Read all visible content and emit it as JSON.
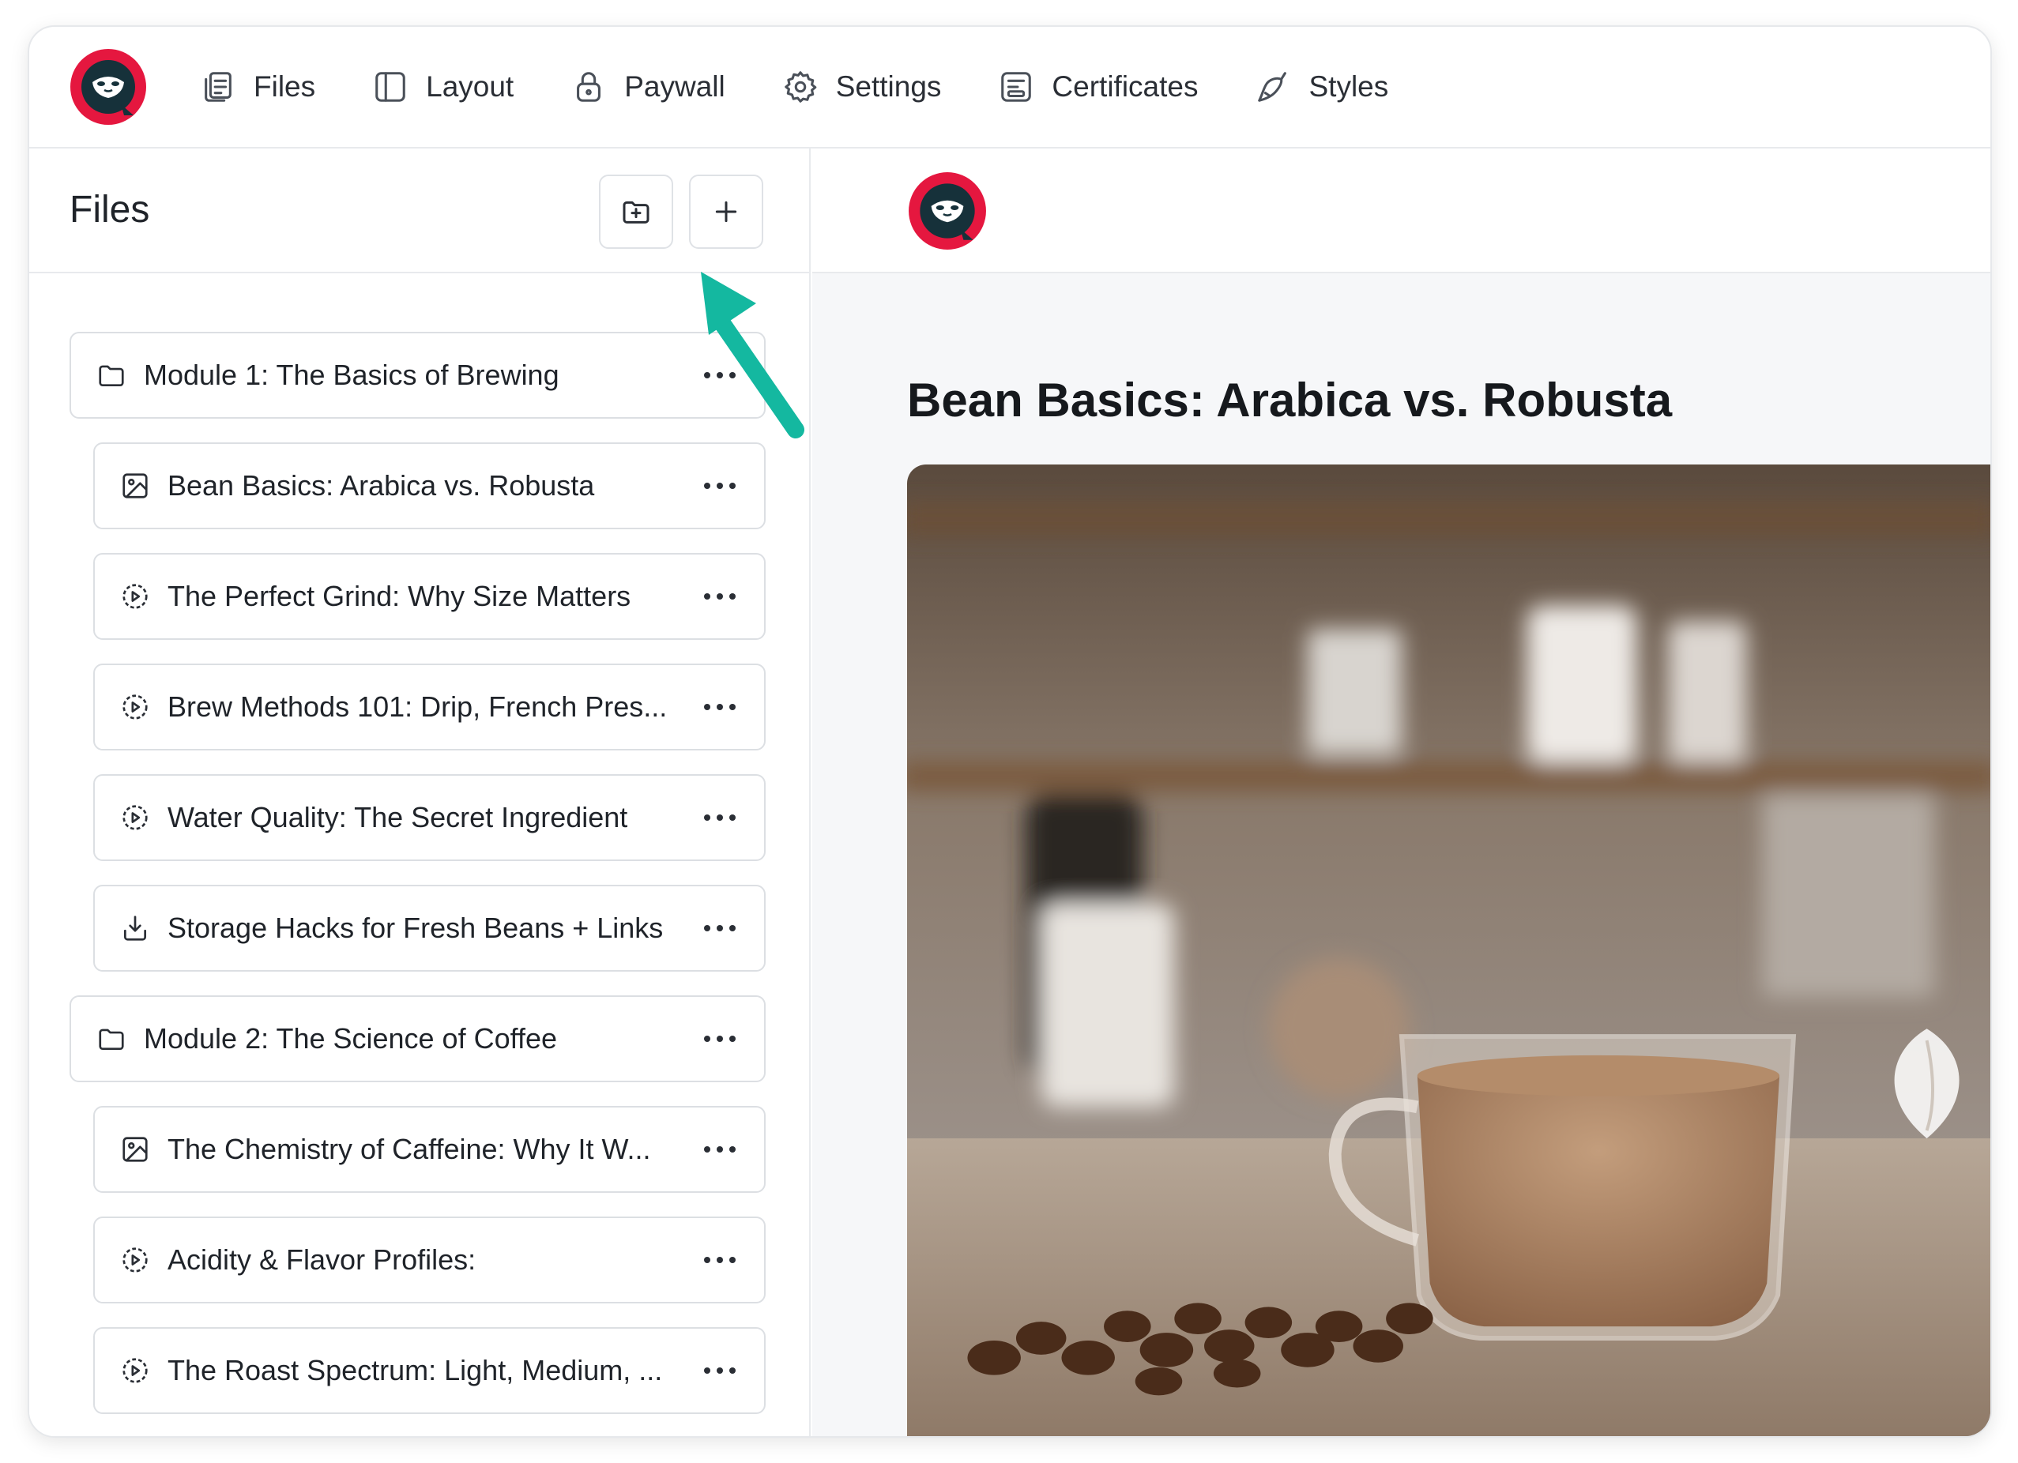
{
  "nav": {
    "items": [
      {
        "label": "Files",
        "icon": "files-icon"
      },
      {
        "label": "Layout",
        "icon": "layout-icon"
      },
      {
        "label": "Paywall",
        "icon": "lock-icon"
      },
      {
        "label": "Settings",
        "icon": "gear-icon"
      },
      {
        "label": "Certificates",
        "icon": "certificate-icon"
      },
      {
        "label": "Styles",
        "icon": "brush-icon"
      }
    ]
  },
  "sidebar": {
    "title": "Files",
    "rows": [
      {
        "type": "folder",
        "label": "Module 1: The Basics of Brewing",
        "icon": "folder-icon"
      },
      {
        "type": "lesson",
        "label": "Bean Basics: Arabica vs. Robusta",
        "icon": "image-icon"
      },
      {
        "type": "lesson",
        "label": "The Perfect Grind: Why Size Matters",
        "icon": "video-icon"
      },
      {
        "type": "lesson",
        "label": "Brew Methods 101: Drip, French Pres...",
        "icon": "video-icon"
      },
      {
        "type": "lesson",
        "label": "Water Quality: The Secret Ingredient",
        "icon": "video-icon"
      },
      {
        "type": "lesson",
        "label": "Storage Hacks for Fresh Beans + Links",
        "icon": "download-icon"
      },
      {
        "type": "folder",
        "label": "Module 2: The Science of Coffee",
        "icon": "folder-icon"
      },
      {
        "type": "lesson",
        "label": "The Chemistry of Caffeine: Why It W...",
        "icon": "image-icon"
      },
      {
        "type": "lesson",
        "label": "Acidity & Flavor Profiles:",
        "icon": "video-icon"
      },
      {
        "type": "lesson",
        "label": "The Roast Spectrum: Light, Medium, ...",
        "icon": "video-icon"
      }
    ]
  },
  "main": {
    "lesson_title": "Bean Basics: Arabica vs. Robusta"
  },
  "colors": {
    "brand_red": "#e5173f",
    "brand_dark": "#16313a",
    "accent_arrow": "#14b8a0"
  }
}
